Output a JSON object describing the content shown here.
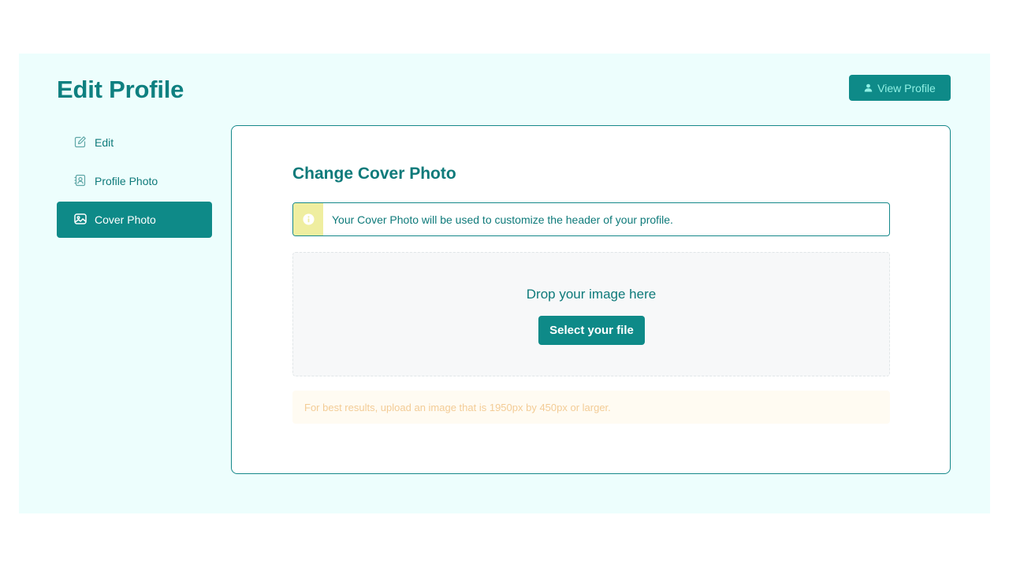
{
  "header": {
    "title": "Edit Profile",
    "view_profile_label": "View Profile",
    "view_profile_icon": "user-icon"
  },
  "sidebar": {
    "items": [
      {
        "label": "Edit",
        "icon": "edit-icon",
        "active": false
      },
      {
        "label": "Profile Photo",
        "icon": "contact-card-icon",
        "active": false
      },
      {
        "label": "Cover Photo",
        "icon": "image-icon",
        "active": true
      }
    ]
  },
  "main": {
    "title": "Change Cover Photo",
    "info_alert": {
      "icon": "info-icon",
      "text": "Your Cover Photo will be used to customize the header of your profile."
    },
    "dropzone": {
      "prompt": "Drop your image here",
      "button_label": "Select your file"
    },
    "hint": "For best results, upload an image that is 1950px by 450px or larger."
  },
  "colors": {
    "accent": "#0e8a88",
    "page_bg": "#edfefd",
    "alert_icon_bg": "#efeea0",
    "hint_text": "#f3cc96",
    "hint_bg": "#fffbf2"
  }
}
